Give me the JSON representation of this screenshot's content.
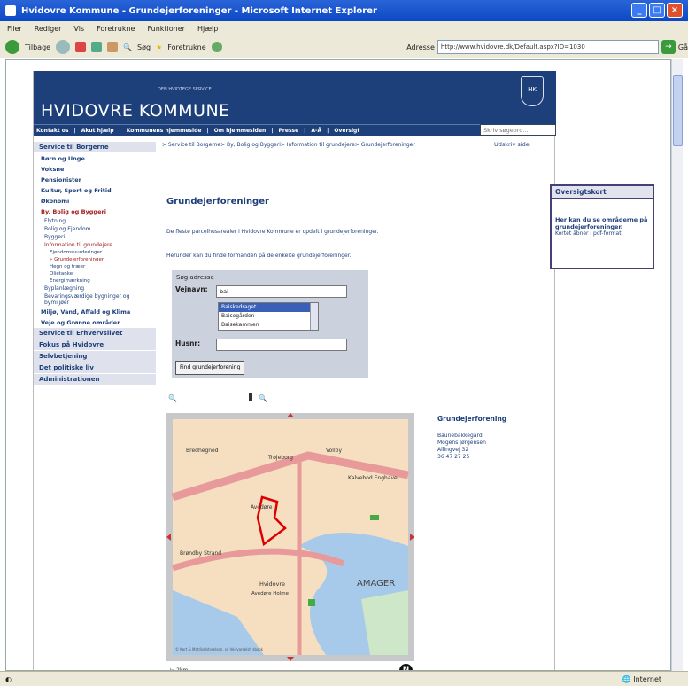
{
  "window": {
    "title": "Hvidovre Kommune - Grundejerforeninger - Microsoft Internet Explorer"
  },
  "menu": [
    "Filer",
    "Rediger",
    "Vis",
    "Foretrukne",
    "Funktioner",
    "Hjælp"
  ],
  "toolbar": {
    "back": "Tilbage",
    "search": "Søg",
    "favorites": "Foretrukne",
    "address_label": "Adresse",
    "address_value": "http://www.hvidovre.dk/Default.aspx?ID=1030",
    "go": "Gå"
  },
  "status": {
    "zone": "Internet"
  },
  "site": {
    "banner_small": "DEN HVIDTEGE SERVICE",
    "banner_name": "HVIDOVRE KOMMUNE",
    "crest": "HK",
    "nav": [
      "Kontakt os",
      "Akut hjælp",
      "Kommunens hjemmeside",
      "Om hjemmesiden",
      "Presse",
      "A-Å",
      "Oversigt"
    ],
    "search_placeholder": "Skriv søgeord..."
  },
  "leftnav": {
    "service_heading": "Service til Borgerne",
    "items": [
      "Børn og Unge",
      "Voksne",
      "Pensionister",
      "Kultur, Sport og Fritid",
      "Økonomi"
    ],
    "active_item": "By, Bolig og Byggeri",
    "sub_items": [
      "Flytning",
      "Bolig og Ejendom",
      "Byggeri"
    ],
    "active_sub": "Information til grundejere",
    "sub_sub_items": [
      "Ejendomsvurderinger",
      "» Grundejerforeninger",
      "Hegn og træer",
      "Olietanke",
      "Energimærkning",
      "Byplanlægning",
      "Bevaringsværdige bygninger og bymiljøer"
    ],
    "more_items": [
      "Miljø, Vand, Affald og Klima",
      "Veje og Grønne områder"
    ],
    "headings": [
      "Service til Erhvervslivet",
      "Fokus på Hvidovre",
      "Selvbetjening",
      "Det politiske liv",
      "Administrationen"
    ]
  },
  "main": {
    "breadcrumb": "> Service til Borgerne> By, Bolig og Byggeri> Information til grundejere> Grundejerforeninger",
    "print": "Udskriv side",
    "title": "Grundejerforeninger",
    "intro": "De fleste parcelhusarealer i Hvidovre Kommune er opdelt i grundejerforeninger.",
    "hint": "Herunder kan du finde formanden på de enkelte grundejerforeninger.",
    "search_label": "Søg adresse",
    "road_label": "Vejnavn:",
    "road_value": "bai",
    "road_options": [
      "Baiskedraget",
      "Baisegården",
      "Baisekammen"
    ],
    "house_label": "Husnr:",
    "find_button": "Find grundejerforening",
    "result_heading": "Grundejerforening",
    "result_lines": [
      "Baunebakkegård",
      "Mogens Jørgensen",
      "Allingvej 32",
      "36 47 27 25"
    ],
    "map_labels": [
      "Bredhegned",
      "Trøjeborg",
      "Vollby",
      "Kalvebod Enghave",
      "Avedøre",
      "Brøndby Strand",
      "Hvidovre",
      "Avedøre Holme",
      "AMAGER"
    ],
    "map_copyright": "© Kort & Matrikelstyrelsen, se Vejrvarselsh sbxbk",
    "scale_text": "2km",
    "compass": "N"
  },
  "right": {
    "heading": "Oversigtskort",
    "text": "Her kan du se områderne på grundejerforeninger.",
    "note": "Kortet åbner i pdf-format."
  }
}
